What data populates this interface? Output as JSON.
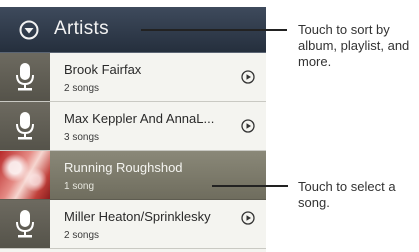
{
  "header": {
    "title": "Artists",
    "menu_icon": "chevron-down-circle-icon"
  },
  "artists": [
    {
      "name": "Brook Fairfax",
      "songs": "2 songs",
      "thumb": "microphone-icon"
    },
    {
      "name": "Max Keppler And AnnaL...",
      "songs": "3 songs",
      "thumb": "microphone-icon"
    },
    {
      "name": "Running Roughshod",
      "songs": "1 song",
      "thumb": "album-art"
    },
    {
      "name": "Miller Heaton/Sprinklesky",
      "songs": "2 songs",
      "thumb": "microphone-icon"
    }
  ],
  "callouts": {
    "sort": "Touch  to sort by album, playlist, and more.",
    "select": "Touch to select a song."
  },
  "colors": {
    "header": "#2e3846",
    "selected_row": "#7d7b6b",
    "row": "#f4f4f0"
  }
}
